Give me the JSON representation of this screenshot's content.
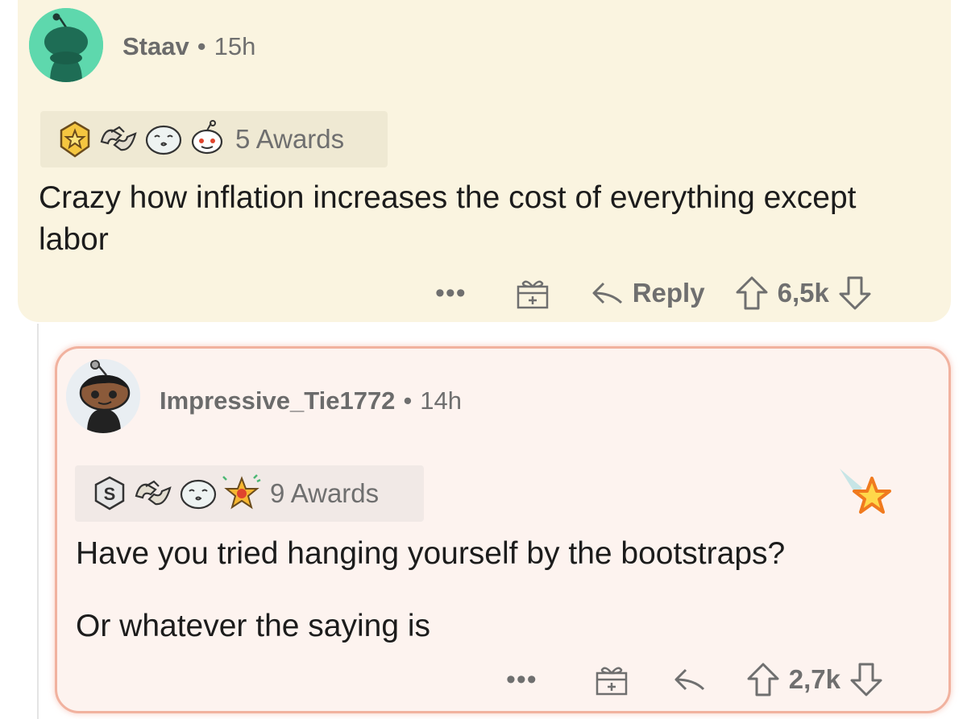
{
  "comments": [
    {
      "username": "Staav",
      "time": "15h",
      "awards_label": "5 Awards",
      "body": [
        "Crazy how inflation increases the cost of everything except labor"
      ],
      "actions": {
        "more": "•••",
        "reply_label": "Reply",
        "score": "6,5k"
      }
    },
    {
      "username": "Impressive_Tie1772",
      "time": "14h",
      "awards_label": "9 Awards",
      "body": [
        "Have you tried hanging yourself by the bootstraps?",
        "Or whatever the saying is"
      ],
      "actions": {
        "more": "•••",
        "score": "2,7k"
      }
    }
  ],
  "separator": "•",
  "colors": {
    "comment1_bg": "#faf4e0",
    "comment2_bg": "#fdf3ef",
    "comment2_border": "#f1b29f",
    "avatar1_bg": "#5ed8ad",
    "meta_text": "#6f6f6f"
  },
  "icons": [
    "snoo-avatar-icon",
    "gold-star-shield-icon",
    "handshake-icon",
    "kiss-face-icon",
    "snoo-face-icon",
    "silver-s-icon",
    "starstruck-icon",
    "gift-icon",
    "reply-arrow-icon",
    "upvote-icon",
    "downvote-icon",
    "shooting-star-icon"
  ]
}
